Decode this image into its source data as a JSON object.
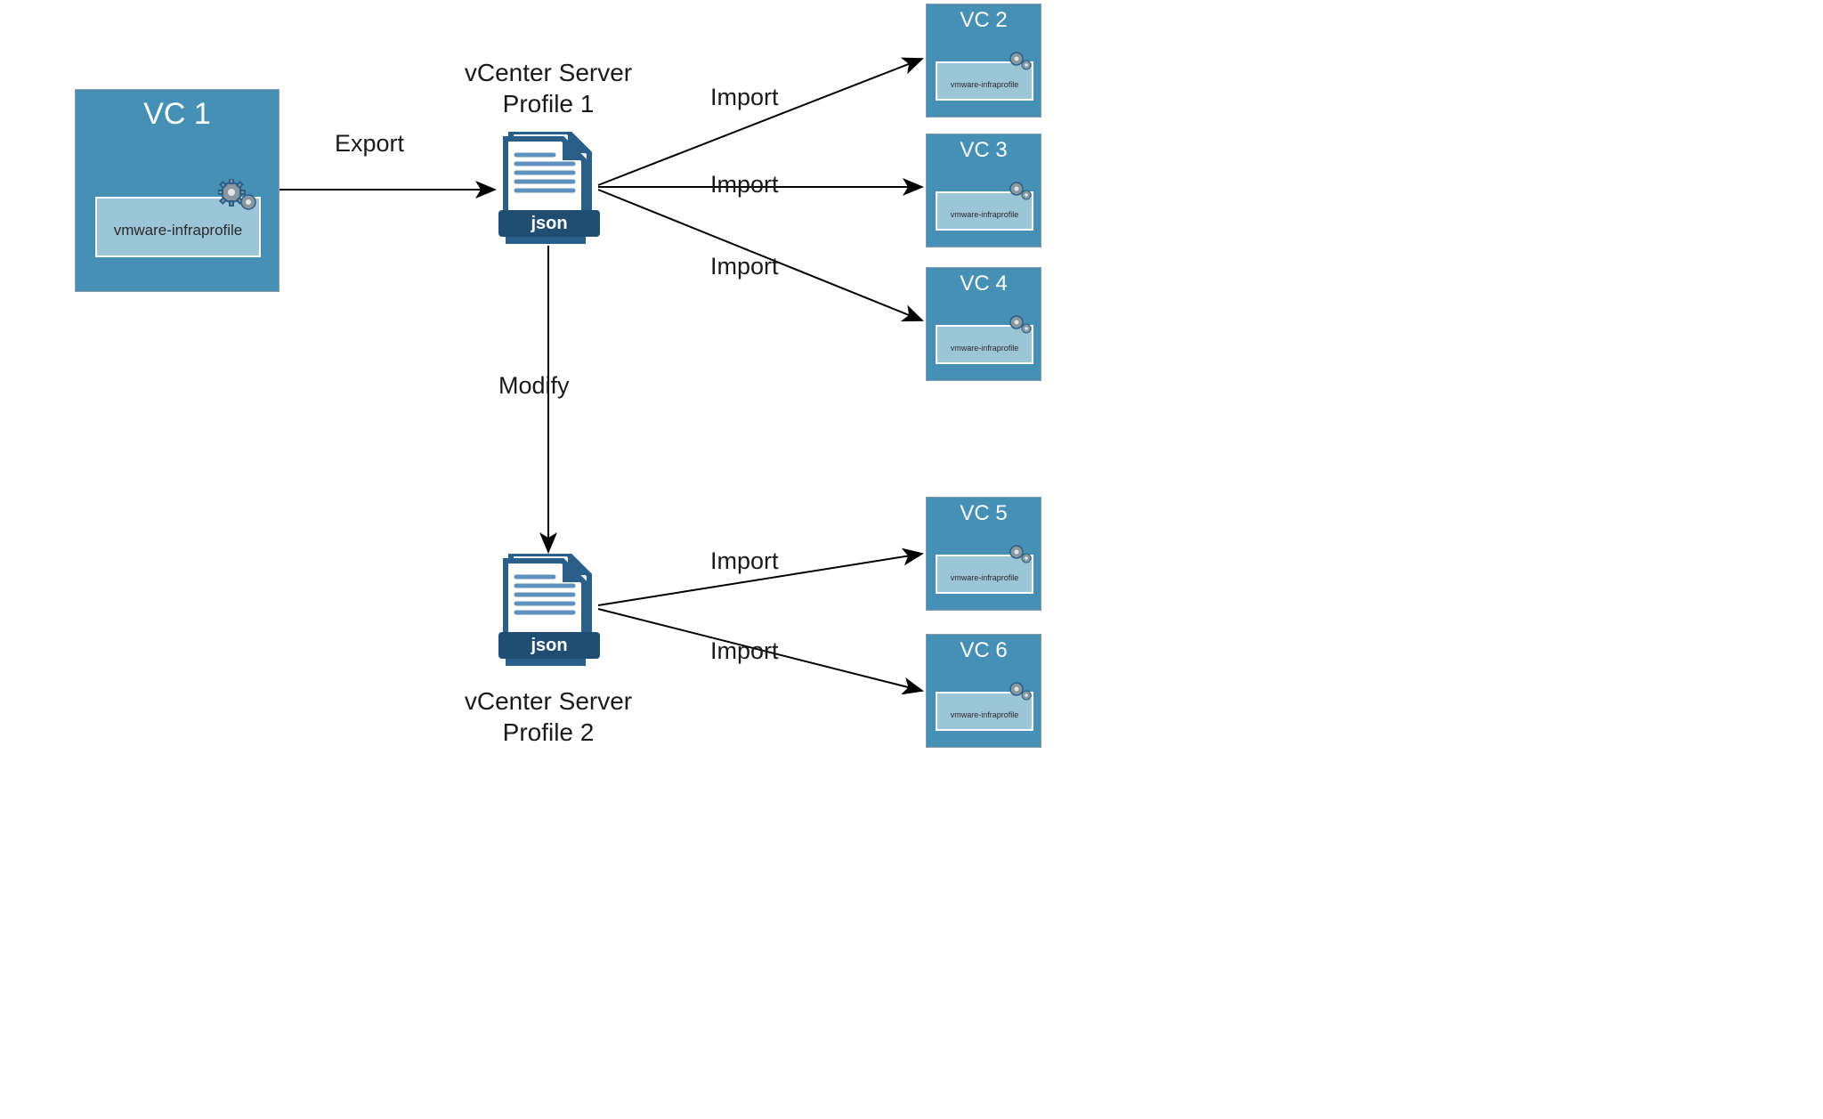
{
  "colors": {
    "vc_box_bg": "#4690b6",
    "vc_inner_bg": "#9dc5d8",
    "file_dark": "#2a5f8a",
    "file_light": "#5e91bd",
    "file_band": "#204d72",
    "gear_fill": "#8a979e",
    "gear_stroke": "#2a5f8a",
    "line": "#000000"
  },
  "nodes": {
    "vc1": {
      "title": "VC 1",
      "inner_label": "vmware-infraprofile"
    },
    "vc2": {
      "title": "VC 2",
      "inner_label": "vmware-infraprofile"
    },
    "vc3": {
      "title": "VC 3",
      "inner_label": "vmware-infraprofile"
    },
    "vc4": {
      "title": "VC 4",
      "inner_label": "vmware-infraprofile"
    },
    "vc5": {
      "title": "VC 5",
      "inner_label": "vmware-infraprofile"
    },
    "vc6": {
      "title": "VC 6",
      "inner_label": "vmware-infraprofile"
    },
    "profile1": {
      "label": "vCenter Server\nProfile 1",
      "file_label": "json"
    },
    "profile2": {
      "label": "vCenter Server\nProfile 2",
      "file_label": "json"
    }
  },
  "edges": {
    "export": "Export",
    "modify": "Modify",
    "import1": "Import",
    "import2": "Import",
    "import3": "Import",
    "import4": "Import",
    "import5": "Import"
  }
}
